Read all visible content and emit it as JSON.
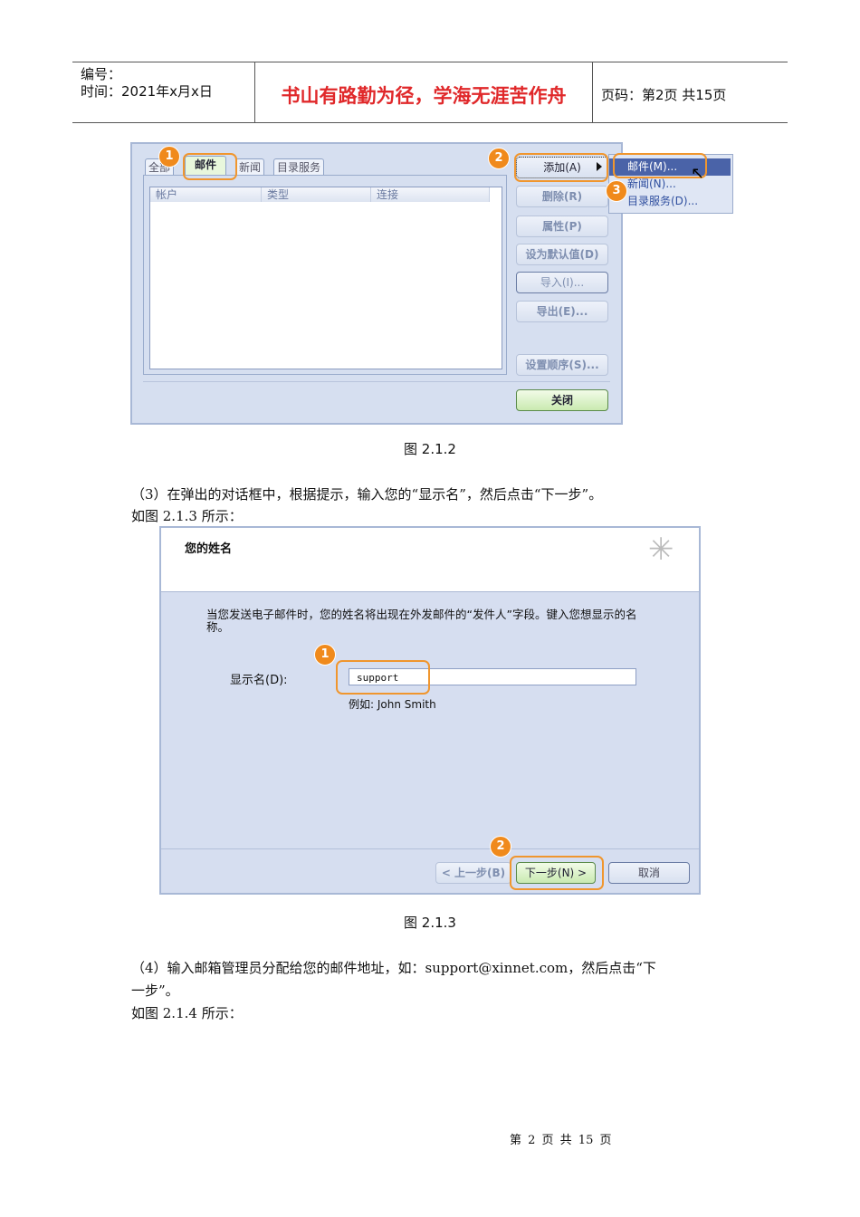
{
  "header": {
    "number_label": "编号：",
    "time_label": "时间：2021年x月x日",
    "motto": "书山有路勤为径，学海无涯苦作舟",
    "page_info": "页码：第2页 共15页",
    "motto_color": "#e0282a"
  },
  "fig1": {
    "tabs": [
      "全部",
      "邮件",
      "新闻",
      "目录服务"
    ],
    "columns": [
      "帐户",
      "类型",
      "连接"
    ],
    "buttons": {
      "add": "添加(A)",
      "remove": "删除(R)",
      "properties": "属性(P)",
      "set_default": "设为默认值(D)",
      "import": "导入(I)...",
      "export": "导出(E)...",
      "order": "设置顺序(S)...",
      "close": "关闭"
    },
    "menu": [
      "邮件(M)...",
      "新闻(N)...",
      "目录服务(D)..."
    ],
    "badges": [
      "1",
      "2",
      "3"
    ],
    "caption": "图 2.1.2"
  },
  "step3": {
    "line1": "（3）在弹出的对话框中，根据提示，输入您的“显示名”，然后点击“下一步”。",
    "line2": "如图 2.1.3 所示："
  },
  "fig2": {
    "title": "您的姓名",
    "desc": "当您发送电子邮件时，您的姓名将出现在外发邮件的“发件人”字段。键入您想显示的名称。",
    "field_label": "显示名(D):",
    "field_value": "support",
    "example": "例如: John Smith",
    "back": "< 上一步(B)",
    "next": "下一步(N) >",
    "cancel": "取消",
    "badges": [
      "1",
      "2"
    ],
    "caption": "图 2.1.3"
  },
  "step4": {
    "line1": "（4）输入邮箱管理员分配给您的邮件地址，如：support@xinnet.com，然后点击“下",
    "line2": "一步”。",
    "line3": "如图 2.1.4 所示："
  },
  "footer": {
    "text": "第 2 页 共 15 页"
  }
}
